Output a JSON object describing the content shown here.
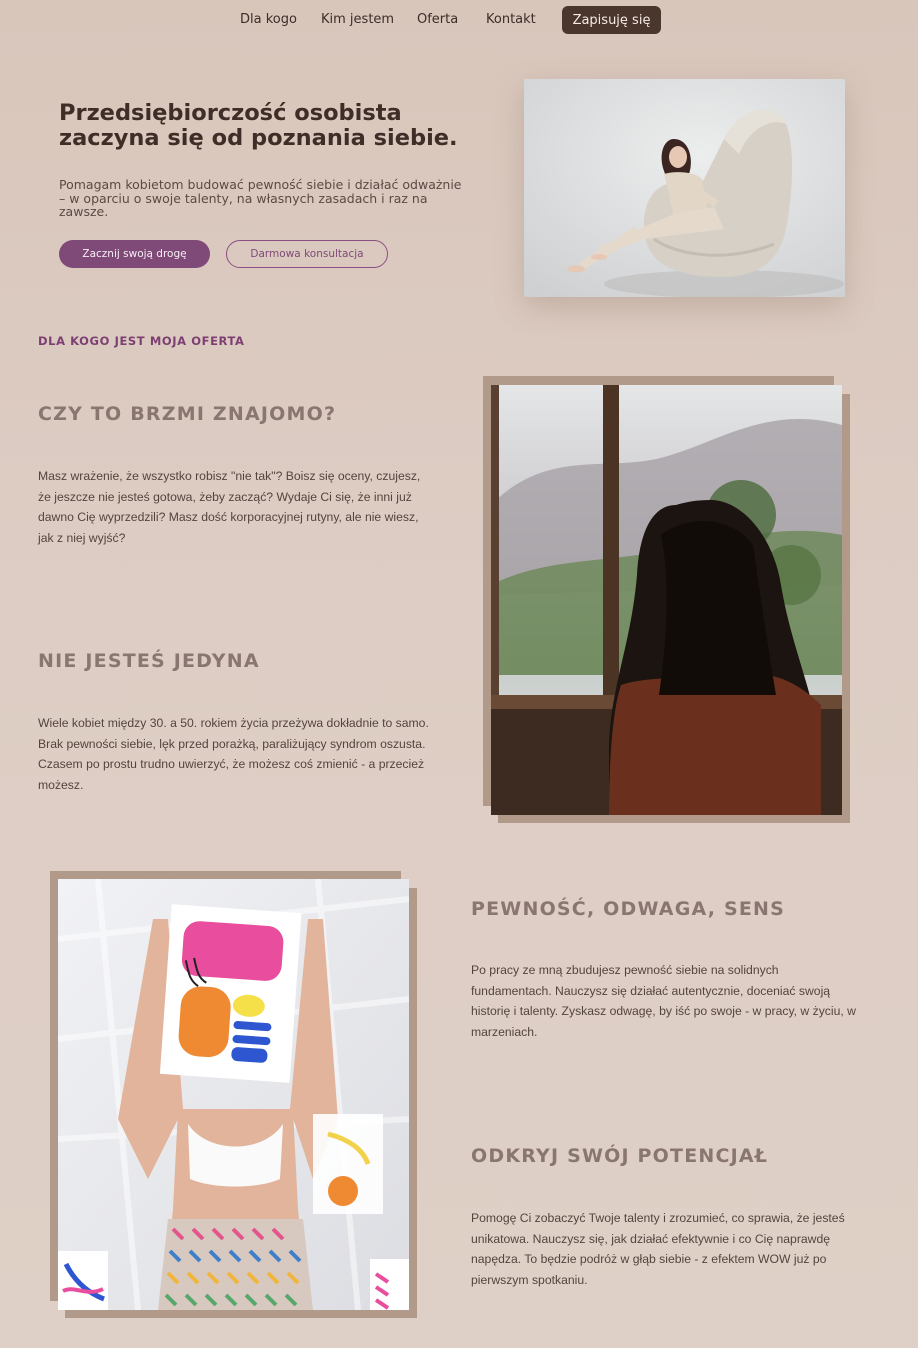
{
  "nav": {
    "links": [
      "Dla kogo",
      "Kim jestem",
      "Oferta",
      "Kontakt"
    ],
    "cta": "Zapisuję się"
  },
  "hero": {
    "title_line1": "Przedsiębiorczość osobista",
    "title_line2": "zaczyna się od poznania siebie.",
    "subtitle": "Pomagam kobietom budować pewność siebie i działać odważnie – w oparciu o swoje talenty, na własnych zasadach i raz na zawsze.",
    "primary_button": "Zacznij swoją drogę",
    "secondary_button": "Darmowa konsultacja"
  },
  "section_label": "DLA KOGO JEST MOJA OFERTA",
  "blocks": [
    {
      "heading": "CZY TO BRZMI ZNAJOMO?",
      "text": "Masz wrażenie, że wszystko robisz \"nie tak\"? Boisz się oceny, czujesz, że jeszcze nie jesteś gotowa, żeby zacząć? Wydaje Ci się, że inni już dawno Cię wyprzedzili? Masz dość korporacyjnej rutyny, ale nie wiesz, jak z niej wyjść?"
    },
    {
      "heading": "NIE JESTEŚ JEDYNA",
      "text": "Wiele kobiet między 30. a 50. rokiem życia przeżywa dokładnie to samo. Brak pewności siebie, lęk przed porażką, paraliżujący syndrom oszusta. Czasem po prostu trudno uwierzyć, że możesz coś zmienić - a przecież możesz."
    },
    {
      "heading": "PEWNOŚĆ, ODWAGA, SENS",
      "text": "Po pracy ze mną zbudujesz pewność siebie na solidnych fundamentach. Nauczysz się działać autentycznie, doceniać swoją historię i talenty. Zyskasz odwagę, by iść po swoje - w pracy, w życiu, w marzeniach."
    },
    {
      "heading": "ODKRYJ SWÓJ POTENCJAŁ",
      "text": "Pomogę Ci zobaczyć Twoje talenty i zrozumieć, co sprawia, że jesteś unikatowa. Nauczysz się, jak działać efektywnie i co Cię naprawdę napędza. To będzie podróż w głąb siebie - z efektem WOW już po pierwszym spotkaniu."
    }
  ],
  "colors": {
    "background": "#dccbc1",
    "accent": "#7f4a78",
    "nav_cta": "#4a362d",
    "frame": "#b29a8a"
  }
}
